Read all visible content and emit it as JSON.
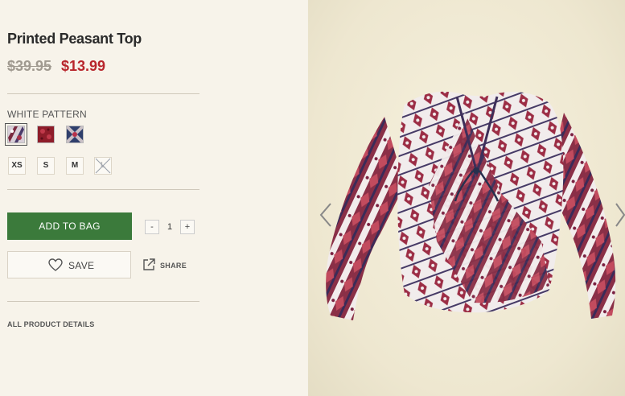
{
  "product": {
    "title": "Printed Peasant Top",
    "price_original": "$39.95",
    "price_sale": "$13.99"
  },
  "color": {
    "label": "WHITE PATTERN",
    "swatches": [
      "white-pattern",
      "red-pattern",
      "navy-pattern"
    ],
    "selected": "white-pattern"
  },
  "sizes": [
    {
      "label": "XS",
      "available": true
    },
    {
      "label": "S",
      "available": true
    },
    {
      "label": "M",
      "available": true
    },
    {
      "label": "L",
      "available": false
    }
  ],
  "actions": {
    "add_to_bag": "ADD TO BAG",
    "qty_minus": "-",
    "qty_value": "1",
    "qty_plus": "+",
    "save": "SAVE",
    "share": "SHARE"
  },
  "details_link": "ALL PRODUCT DETAILS",
  "colors": {
    "accent_green": "#3b7a3b",
    "sale_red": "#b8262c"
  },
  "icons": {
    "heart": "heart-icon",
    "share": "share-icon",
    "prev": "chevron-left-icon",
    "next": "chevron-right-icon"
  }
}
